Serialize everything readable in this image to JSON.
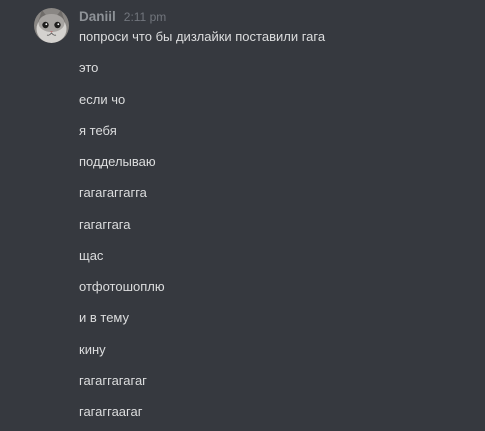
{
  "author": {
    "name": "Daniil",
    "timestamp": "2:11 pm",
    "avatar": "cat-avatar"
  },
  "messages": [
    "попроси что бы дизлайки поставили гага",
    "это",
    "если чо",
    "я тебя",
    "подделываю",
    "гагагаггагга",
    "гагаггага",
    "щас",
    "отфотошоплю",
    "и в тему",
    "кину",
    "гагаггагагаг",
    "гагаггаагаг"
  ],
  "colors": {
    "background": "#36393f",
    "username": "#8e9297",
    "timestamp": "#72767d",
    "message_text": "#dcddde"
  }
}
